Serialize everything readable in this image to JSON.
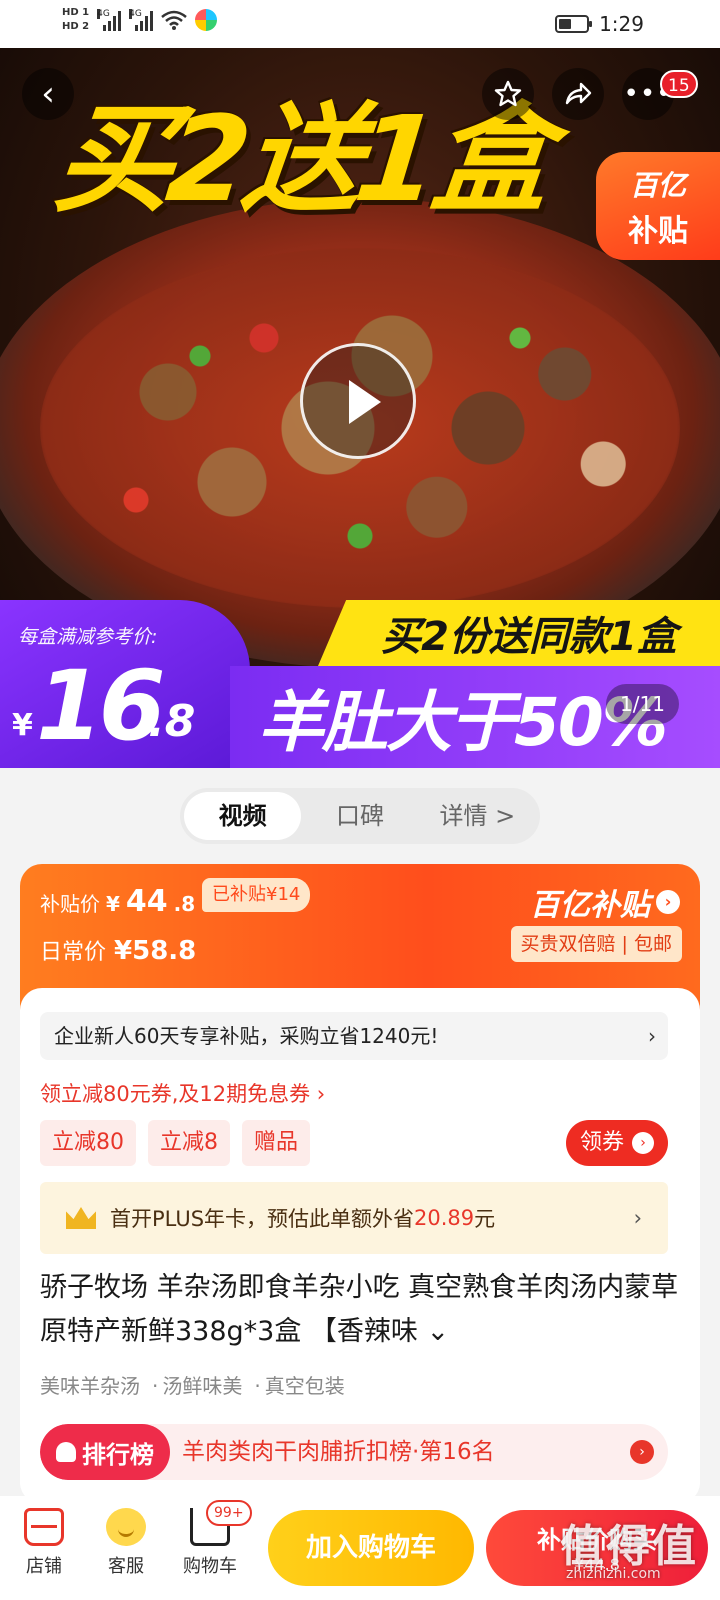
{
  "status_bar": {
    "hd1": "HD 1",
    "hd2": "HD 2",
    "net1": "4G",
    "net2": "4G",
    "time": "1:29"
  },
  "hero": {
    "headline": "买2送1盒",
    "cart_count": "15",
    "subsidy_corner_line1": "百亿",
    "subsidy_corner_line2": "补贴",
    "price_label": "每盒满减参考价:",
    "price_currency": "¥",
    "price_int": "16",
    "price_dec": ".8",
    "promo_line1": "买2份送同款1盒",
    "promo_line2": "羊肚大于50%",
    "page_counter": "1/11"
  },
  "tabs": [
    {
      "label": "视频"
    },
    {
      "label": "口碑"
    },
    {
      "label": "详情 >"
    }
  ],
  "subsidy": {
    "price_label": "补贴价",
    "currency": "¥",
    "price_int": "44",
    "price_dec": ".8",
    "subsidized_chip": "已补贴¥14",
    "daily_label": "日常价",
    "daily_price": "¥58.8",
    "brand": "百亿补贴",
    "guarantee": "买贵双倍赔 | 包邮"
  },
  "offers": {
    "new_user_text": "企业新人60天专享补贴，采购立省1240元!",
    "coupon_line": "领立减80元券,及12期免息券 ›",
    "chips": [
      "立减80",
      "立减8",
      "赠品"
    ],
    "get_coupon": "领券",
    "plus_prefix": "首开PLUS年卡，预估此单额外省",
    "plus_amount": "20.89",
    "plus_suffix": "元"
  },
  "product": {
    "title": "骄子牧场 羊杂汤即食羊杂小吃 真空熟食羊肉汤内蒙草原特产新鲜338g*3盒 【香辣味 ⌄",
    "tags": [
      "美味羊杂汤",
      "汤鲜味美",
      "真空包装"
    ],
    "rank_tag": "排行榜",
    "rank_text": "羊肉类肉干肉脯折扣榜·第16名"
  },
  "bottom_bar": {
    "store": "店铺",
    "service": "客服",
    "cart": "购物车",
    "cart_badge": "99+",
    "add_to_cart": "加入购物车",
    "buy_now": "补贴价购买",
    "buy_now_price": "¥44.8",
    "watermark": "值得值",
    "watermark_url": "zhizhizhi.com"
  },
  "colors": {
    "accent_red": "#e8362a",
    "subsidy_orange": "#ff5a1c",
    "promo_yellow": "#ffe312",
    "promo_purple": "#7b2cf2"
  }
}
